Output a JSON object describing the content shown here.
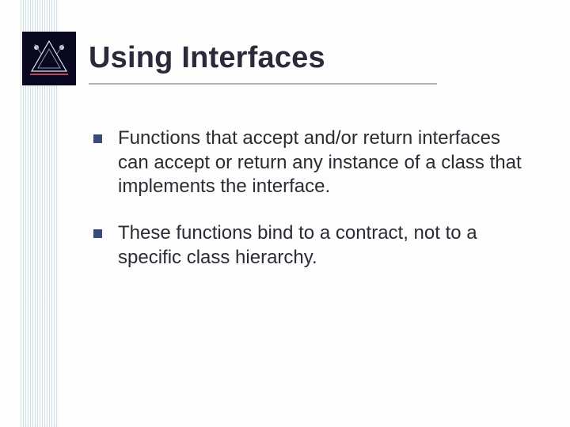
{
  "slide": {
    "title": "Using Interfaces",
    "bullets": [
      "Functions that accept and/or return interfaces can accept or return any instance of a class that implements the interface.",
      "These functions bind to a contract, not to a specific class hierarchy."
    ]
  }
}
